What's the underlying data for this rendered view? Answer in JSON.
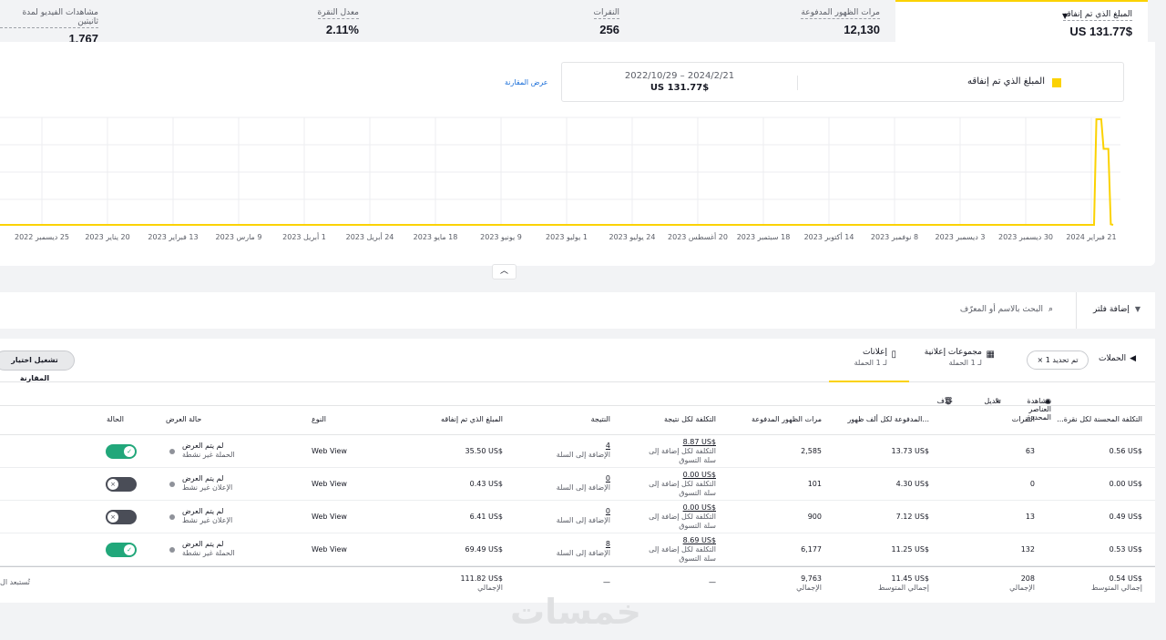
{
  "metrics": [
    {
      "label": "المبلغ الذي تم إنفاقه",
      "value": "$US 131.77"
    },
    {
      "label": "مرات الظهور المدفوعة",
      "value": "12,130"
    },
    {
      "label": "النقرات",
      "value": "256"
    },
    {
      "label": "معدل النقرة",
      "value": "2.11%"
    },
    {
      "label": "مشاهدات الفيديو لمدة ثانيتين",
      "value": "1,767"
    }
  ],
  "legend": {
    "metric_label": "المبلغ الذي تم إنفاقه",
    "date_range": "2024/2/21 – 2022/10/29",
    "amount": "$US 131.77",
    "compare_link": "عرض المقارنة",
    "swatch_color": "#fbd202"
  },
  "chart_data": {
    "type": "line",
    "x_tick_labels": [
      "21 فبراير 2024",
      "30 ديسمبر 2023",
      "3 ديسمبر 2023",
      "8 نوفمبر 2023",
      "14 أكتوبر 2023",
      "18 سبتمبر 2023",
      "20 أغسطس 2023",
      "24 يوليو 2023",
      "1 يوليو 2023",
      "9 يونيو 2023",
      "18 مايو 2023",
      "24 أبريل 2023",
      "1 أبريل 2023",
      "9 مارس 2023",
      "13 فبراير 2023",
      "20 يناير 2023",
      "25 ديسمبر 2022"
    ],
    "series": [
      {
        "color": "#fbd202",
        "x": [
          "2022-10-29",
          "2024-02-13",
          "2024-02-14",
          "2024-02-15",
          "2024-02-16",
          "2024-02-17",
          "2024-02-18",
          "2024-02-19",
          "2024-02-20",
          "2024-02-21"
        ],
        "values": [
          0,
          0,
          69.49,
          69.49,
          69.49,
          50.0,
          50.0,
          50.0,
          0.43,
          0
        ]
      }
    ],
    "grid": true
  },
  "filter": {
    "add_filter": "إضافة فلتر",
    "search_placeholder": "البحث بالاسم أو المعرّف"
  },
  "tabs": {
    "campaigns": "الحملات",
    "selected_chip": "تم تحديد 1",
    "ad_groups": "مجموعات إعلانية",
    "ad_groups_sub": "لـ 1 الحملة",
    "ads": "إعلانات",
    "ads_sub": "لـ 1 الحملة",
    "run_compare": "تشغيل اختيار المقارنة"
  },
  "actions": {
    "view_selected": "مشاهدة العناصر المحددة",
    "edit": "تعديل",
    "delete": "حذف"
  },
  "columns": {
    "cpc": "التكلفة المحسنة لكل نقرة...",
    "clicks": "النقرات",
    "cpm": "...المدفوعة لكل ألف ظهور",
    "impressions": "مرات الظهور المدفوعة",
    "cost_per_result": "التكلفة لكل نتيجة",
    "result": "النتيجة",
    "spend": "المبلغ الذي تم إنفاقه",
    "type": "النوع",
    "delivery": "حالة العرض",
    "status": "الحالة"
  },
  "rows": [
    {
      "cpc": "0.56 US$",
      "clicks": "63",
      "cpm": "13.73 US$",
      "impressions": "2,585",
      "cpr": "8.87 US$",
      "cpr_sub1": "التكلفة لكل إضافة إلى",
      "cpr_sub2": "سلة التسوق",
      "result": "4",
      "result_sub": "الإضافة إلى السلة",
      "spend": "35.50 US$",
      "type": "Web View",
      "delivery": "لم يتم العرض",
      "delivery_sub": "الحملة غير نشطة",
      "on": true
    },
    {
      "cpc": "0.00 US$",
      "clicks": "0",
      "cpm": "4.30 US$",
      "impressions": "101",
      "cpr": "0.00 US$",
      "cpr_sub1": "التكلفة لكل إضافة إلى",
      "cpr_sub2": "سلة التسوق",
      "result": "0",
      "result_sub": "الإضافة إلى السلة",
      "spend": "0.43 US$",
      "type": "Web View",
      "delivery": "لم يتم العرض",
      "delivery_sub": "الإعلان غير نشط",
      "on": false
    },
    {
      "cpc": "0.49 US$",
      "clicks": "13",
      "cpm": "7.12 US$",
      "impressions": "900",
      "cpr": "0.00 US$",
      "cpr_sub1": "التكلفة لكل إضافة إلى",
      "cpr_sub2": "سلة التسوق",
      "result": "0",
      "result_sub": "الإضافة إلى السلة",
      "spend": "6.41 US$",
      "type": "Web View",
      "delivery": "لم يتم العرض",
      "delivery_sub": "الإعلان غير نشط",
      "on": false
    },
    {
      "cpc": "0.53 US$",
      "clicks": "132",
      "cpm": "11.25 US$",
      "impressions": "6,177",
      "cpr": "8.69 US$",
      "cpr_sub1": "التكلفة لكل إضافة إلى",
      "cpr_sub2": "سلة التسوق",
      "result": "8",
      "result_sub": "الإضافة إلى السلة",
      "spend": "69.49 US$",
      "type": "Web View",
      "delivery": "لم يتم العرض",
      "delivery_sub": "الحملة غير نشطة",
      "on": true
    }
  ],
  "totals": {
    "cpc": "0.54 US$",
    "cpc_sub": "إجمالي المتوسط",
    "clicks": "208",
    "clicks_sub": "الإجمالي",
    "cpm": "11.45 US$",
    "cpm_sub": "إجمالي المتوسط",
    "impressions": "9,763",
    "impressions_sub": "الإجمالي",
    "cpr": "—",
    "result": "—",
    "spend": "111.82 US$",
    "spend_sub": "الإجمالي",
    "excluded": "تُستبعد ال"
  },
  "watermark": "خمسات"
}
